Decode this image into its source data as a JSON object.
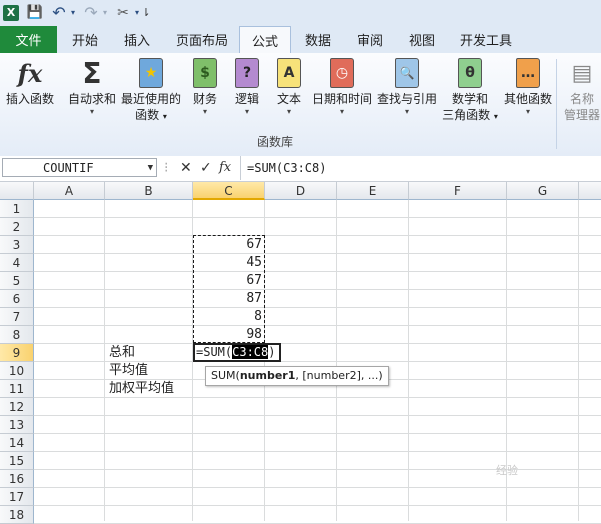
{
  "qat": {
    "logo": "X",
    "save": "💾",
    "undo": "↶",
    "redo": "↷",
    "tool": "✂",
    "more": "⇂"
  },
  "tabs": [
    "文件",
    "开始",
    "插入",
    "页面布局",
    "公式",
    "数据",
    "审阅",
    "视图",
    "开发工具"
  ],
  "active_tab": "公式",
  "ribbon": {
    "buttons": [
      {
        "label": "插入函数",
        "icon": "fx"
      },
      {
        "label": "自动求和",
        "icon": "Σ"
      },
      {
        "label": "最近使用的",
        "sublabel": "函数",
        "icon": "★"
      },
      {
        "label": "财务",
        "icon": "$"
      },
      {
        "label": "逻辑",
        "icon": "?"
      },
      {
        "label": "文本",
        "icon": "A"
      },
      {
        "label": "日期和时间",
        "icon": "◷"
      },
      {
        "label": "查找与引用",
        "icon": "🔍"
      },
      {
        "label": "数学和",
        "sublabel": "三角函数",
        "icon": "θ"
      },
      {
        "label": "其他函数",
        "icon": "…"
      },
      {
        "label": "名称",
        "sublabel": "管理器",
        "icon": "▤"
      }
    ],
    "group_label": "函数库"
  },
  "formula_bar": {
    "name_box": "COUNTIF",
    "cancel": "✕",
    "enter": "✓",
    "fx": "fx",
    "formula": "=SUM(C3:C8)"
  },
  "sheet": {
    "columns": [
      "A",
      "B",
      "C",
      "D",
      "E",
      "F",
      "G"
    ],
    "rows": [
      "1",
      "2",
      "3",
      "4",
      "5",
      "6",
      "7",
      "8",
      "9",
      "10",
      "11",
      "12",
      "13",
      "14",
      "15",
      "16",
      "17",
      "18"
    ],
    "c_values": [
      "67",
      "45",
      "67",
      "87",
      "8",
      "98"
    ],
    "b_labels": [
      "总和",
      "平均值",
      "加权平均值"
    ],
    "edit_prefix": "=SUM(",
    "edit_ref": "C3:C8",
    "edit_suffix": ")",
    "tooltip_fn": "SUM(",
    "tooltip_arg1": "number1",
    "tooltip_rest": ", [number2], ...)"
  },
  "watermark": "经验"
}
